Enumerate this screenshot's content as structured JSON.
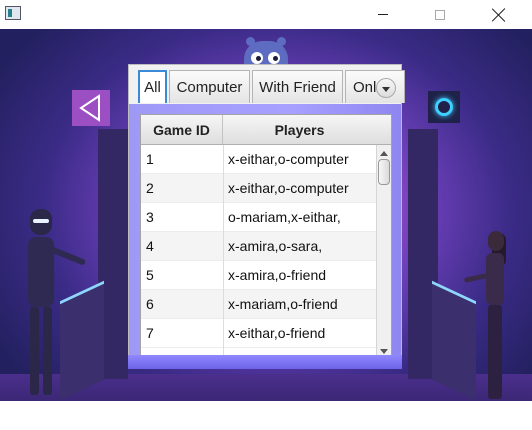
{
  "window": {
    "title": "",
    "controls": {
      "minimize": "minimize",
      "maximize": "maximize",
      "close": "close"
    }
  },
  "tabs": [
    {
      "label": "All",
      "active": true
    },
    {
      "label": "Computer",
      "active": false
    },
    {
      "label": "With Friend",
      "active": false
    },
    {
      "label": "Onl",
      "active": false
    }
  ],
  "table": {
    "columns": [
      "Game ID",
      "Players"
    ],
    "rows": [
      {
        "id": "1",
        "players": "x-eithar,o-computer"
      },
      {
        "id": "2",
        "players": "x-eithar,o-computer"
      },
      {
        "id": "3",
        "players": "o-mariam,x-eithar,"
      },
      {
        "id": "4",
        "players": "x-amira,o-sara,"
      },
      {
        "id": "5",
        "players": "x-amira,o-friend"
      },
      {
        "id": "6",
        "players": "x-mariam,o-friend"
      },
      {
        "id": "7",
        "players": "x-eithar,o-friend"
      }
    ]
  },
  "icons": {
    "back": "back-arrow-icon",
    "power": "power-icon",
    "tab_overflow": "chevron-down-icon"
  },
  "colors": {
    "accent": "#3a8ad8",
    "back_button": "#9b4fc2",
    "power_glow": "#3fd0ff",
    "panel_fill": "#a7a0ff"
  }
}
